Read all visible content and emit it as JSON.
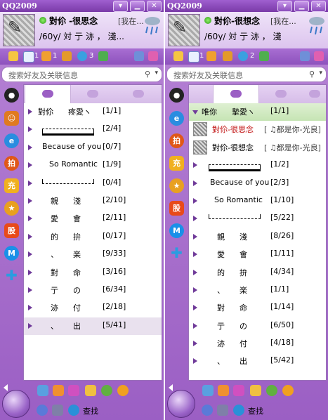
{
  "windows": [
    {
      "title": "QQ2009",
      "profile": {
        "nickname": "對伱 -很思念",
        "status_text": "[我在...",
        "signature": "/60y/ 対 亍 洂 ，   淺...",
        "avatar_glyph": "戦"
      },
      "iconbar_counts": [
        "1",
        "1",
        "3"
      ],
      "search_placeholder": "搜索好友及关联信息",
      "groups": [
        {
          "name": "對伱      疼愛ヽ",
          "count": "[1/1]",
          "kind": "text"
        },
        {
          "name": "",
          "count": "[2/4]",
          "kind": "bracket-top"
        },
        {
          "name": "Because of you",
          "count": "[0/7]",
          "kind": "text"
        },
        {
          "name": "So Romantic",
          "count": "[1/9]",
          "kind": "text"
        },
        {
          "name": "",
          "count": "[0/4]",
          "kind": "bracket-bot"
        },
        {
          "name": "親      淺",
          "count": "[2/10]",
          "kind": "text"
        },
        {
          "name": "愛      會",
          "count": "[2/11]",
          "kind": "text"
        },
        {
          "name": "的      拚",
          "count": "[0/17]",
          "kind": "text"
        },
        {
          "name": "、      楽",
          "count": "[9/33]",
          "kind": "text"
        },
        {
          "name": "對      命",
          "count": "[3/16]",
          "kind": "text"
        },
        {
          "name": "亍      の",
          "count": "[6/34]",
          "kind": "text"
        },
        {
          "name": "洂      付",
          "count": "[2/18]",
          "kind": "text"
        },
        {
          "name": "、      出",
          "count": "[5/41]",
          "kind": "text"
        }
      ],
      "find_label": "查找"
    },
    {
      "title": "QQ2009",
      "profile": {
        "nickname": "對伱-很想念",
        "status_text": "[我在...",
        "signature": "/60y/ 対 亍 洂 ，  淺",
        "avatar_glyph": "戦"
      },
      "iconbar_counts": [
        "1",
        "2"
      ],
      "search_placeholder": "搜索好友及关联信息",
      "groups": [
        {
          "name": "唯你      摯愛ヽ",
          "count": "[1/1]",
          "kind": "open"
        },
        {
          "name": "對伱-很思念",
          "count": "[ ♫都是你-光良]",
          "kind": "contact",
          "color": "#c01010"
        },
        {
          "name": "對伱-很想念",
          "count": "[ ♫都是你-光良]",
          "kind": "contact",
          "color": "#000000"
        },
        {
          "name": "",
          "count": "[1/2]",
          "kind": "bracket-top"
        },
        {
          "name": "Because of you",
          "count": "[2/3]",
          "kind": "text"
        },
        {
          "name": "So Romantic",
          "count": "[1/10]",
          "kind": "text"
        },
        {
          "name": "",
          "count": "[5/22]",
          "kind": "bracket-bot"
        },
        {
          "name": "親      淺",
          "count": "[8/26]",
          "kind": "text"
        },
        {
          "name": "愛      會",
          "count": "[1/11]",
          "kind": "text"
        },
        {
          "name": "的      拚",
          "count": "[4/34]",
          "kind": "text"
        },
        {
          "name": "、      楽",
          "count": "[1/1]",
          "kind": "text"
        },
        {
          "name": "對      命",
          "count": "[1/14]",
          "kind": "text"
        },
        {
          "name": "亍      の",
          "count": "[6/50]",
          "kind": "text"
        },
        {
          "name": "洂      付",
          "count": "[4/18]",
          "kind": "text"
        },
        {
          "name": "、      出",
          "count": "[5/42]",
          "kind": "text"
        }
      ],
      "find_label": "查找"
    }
  ],
  "sidebar_labels": [
    "拍",
    "充",
    "股"
  ],
  "colors": {
    "accent": "#9b5fc4",
    "titlebar": "#7a3aa8",
    "group_arrow": "#6f3a99",
    "open_group": "#c6e4b4"
  }
}
